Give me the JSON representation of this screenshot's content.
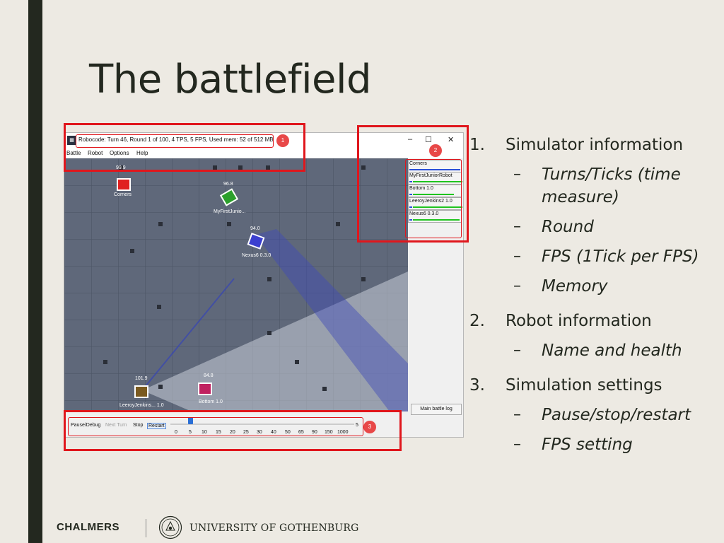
{
  "slide": {
    "title": "The battlefield"
  },
  "window": {
    "title": "Robocode: Turn 46, Round 1 of 100, 4 TPS, 5 FPS, Used mem: 52 of 512 MB",
    "icon": "robocode-app-icon",
    "controls": {
      "minimize": "–",
      "maximize": "☐",
      "close": "✕"
    },
    "menu": [
      "Battle",
      "Robot",
      "Options",
      "Help"
    ]
  },
  "arena": {
    "robots": [
      {
        "name": "Corners",
        "energy": "99.9",
        "color": "#e02020"
      },
      {
        "name": "MyFirstJunio...",
        "energy": "96.8",
        "color": "#2ca02c"
      },
      {
        "name": "Nexus6 0.3.0",
        "energy": "94.0",
        "color": "#3b3fd0"
      },
      {
        "name": "LeeroyJenkins... 1.0",
        "energy": "101.9",
        "color": "#7a5a20"
      },
      {
        "name": "Bottom 1.0",
        "energy": "84.8",
        "color": "#c02060"
      }
    ]
  },
  "robot_panel": {
    "entries": [
      {
        "name": "Corners",
        "health": 0.98
      },
      {
        "name": "MyFirstJuniorRobot",
        "health": 0.96
      },
      {
        "name": "Bottom 1.0",
        "health": 0.82
      },
      {
        "name": "LeeroyJenkins2 1.0",
        "health": 1.0
      },
      {
        "name": "Nexus6 0.3.0",
        "health": 0.94
      }
    ],
    "main_log_button": "Main battle log"
  },
  "controls": {
    "pause": "Pause/Debug",
    "next_turn": "Next Turn",
    "stop": "Stop",
    "restart": "Restart",
    "tps_labels": [
      "0",
      "5",
      "10",
      "15",
      "20",
      "25",
      "30",
      "40",
      "50",
      "65",
      "90",
      "150",
      "1000"
    ],
    "tps_value": "5",
    "slider_value": 5
  },
  "annotations": [
    "1",
    "2",
    "3"
  ],
  "bullets": {
    "items": [
      {
        "num": "1.",
        "text": "Simulator information",
        "subs": [
          "Turns/Ticks (time",
          "measure)",
          "Round",
          "FPS (1Tick per FPS)",
          "Memory"
        ]
      },
      {
        "num": "2.",
        "text": "Robot information",
        "subs": [
          "Name and health"
        ]
      },
      {
        "num": "3.",
        "text": "Simulation settings",
        "subs": [
          "Pause/stop/restart",
          "FPS setting"
        ]
      }
    ],
    "dash": "–"
  },
  "footer": {
    "left": "CHALMERS",
    "right": "UNIVERSITY OF GOTHENBURG",
    "seal_icon": "gothenburg-university-seal"
  },
  "colors": {
    "highlight": "#e0161c",
    "slide_bg": "#edeae3",
    "accent_bar": "#23281f"
  }
}
